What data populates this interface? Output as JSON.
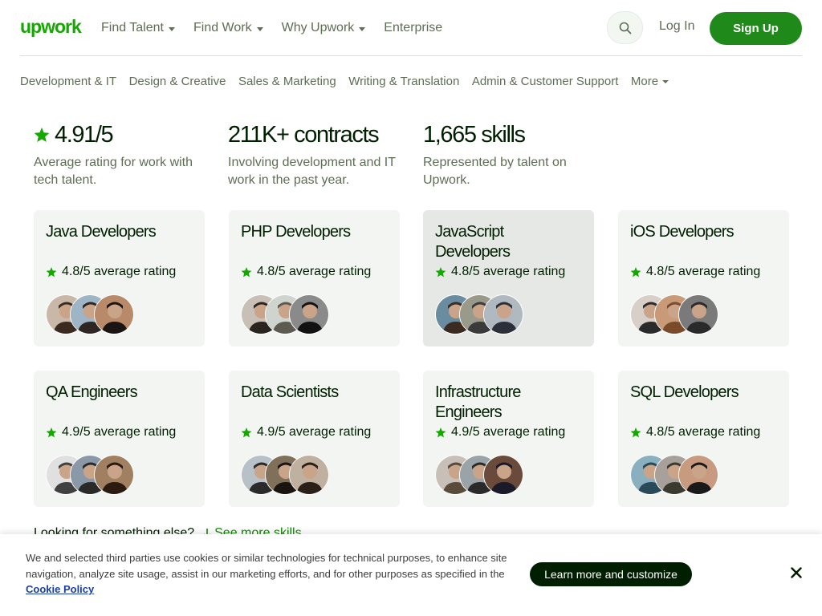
{
  "header": {
    "logo_text": "upwork",
    "nav": [
      {
        "label": "Find Talent",
        "has_caret": true
      },
      {
        "label": "Find Work",
        "has_caret": true
      },
      {
        "label": "Why Upwork",
        "has_caret": true
      },
      {
        "label": "Enterprise",
        "has_caret": false
      }
    ],
    "search_icon": "search-icon",
    "login_label": "Log In",
    "signup_label": "Sign Up"
  },
  "categories": {
    "items": [
      "Development & IT",
      "Design & Creative",
      "Sales & Marketing",
      "Writing & Translation",
      "Admin & Customer Support"
    ],
    "more_label": "More"
  },
  "stats": [
    {
      "title": "4.91/5",
      "icon": "star-icon",
      "desc": "Average rating for work with tech talent."
    },
    {
      "title": "211K+ contracts",
      "desc": "Involving development and IT work in the past year."
    },
    {
      "title": "1,665 skills",
      "desc": "Represented by talent on Upwork."
    }
  ],
  "cards": [
    {
      "title": "Java Developers",
      "rating": "4.8/5 average rating"
    },
    {
      "title": "PHP Developers",
      "rating": "4.8/5 average rating"
    },
    {
      "title": "JavaScript Developers",
      "rating": "4.8/5 average rating"
    },
    {
      "title": "iOS Developers",
      "rating": "4.8/5 average rating"
    },
    {
      "title": "QA Engineers",
      "rating": "4.9/5 average rating"
    },
    {
      "title": "Data Scientists",
      "rating": "4.9/5 average rating"
    },
    {
      "title": "Infrastructure Engineers",
      "rating": "4.9/5 average rating"
    },
    {
      "title": "SQL Developers",
      "rating": "4.8/5 average rating"
    }
  ],
  "more_skills": {
    "question": "Looking for something else?",
    "link_label": "See more skills"
  },
  "cookie": {
    "text": "We and selected third parties use cookies or similar technologies for technical purposes, to enhance site navigation, analyze site usage, assist in our marketing efforts, and for other purposes as specified in the",
    "policy_label": "Cookie Policy",
    "button_label": "Learn more and customize",
    "close_icon": "close-icon"
  },
  "colors": {
    "brand_green": "#14a800",
    "text_dark": "#001e00",
    "text_muted": "#5e6d55",
    "card_bg": "#f2f5f2"
  }
}
